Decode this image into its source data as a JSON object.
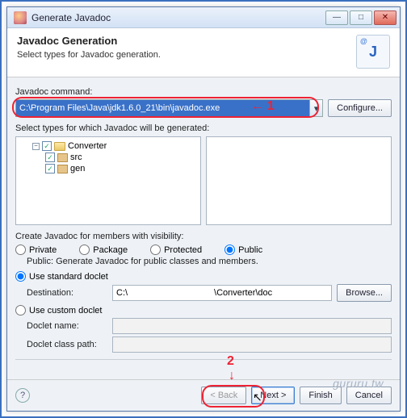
{
  "window": {
    "title": "Generate Javadoc"
  },
  "header": {
    "title": "Javadoc Generation",
    "subtitle": "Select types for Javadoc generation."
  },
  "cmd": {
    "label": "Javadoc command:",
    "value": "C:\\Program Files\\Java\\jdk1.6.0_21\\bin\\javadoc.exe",
    "configure": "Configure..."
  },
  "types": {
    "label": "Select types for which Javadoc will be generated:",
    "tree": {
      "project": "Converter",
      "children": [
        "src",
        "gen"
      ]
    }
  },
  "visibility": {
    "label": "Create Javadoc for members with visibility:",
    "options": [
      "Private",
      "Package",
      "Protected",
      "Public"
    ],
    "selected": "Public",
    "note": "Public: Generate Javadoc for public classes and members."
  },
  "doclet": {
    "standard_label": "Use standard doclet",
    "dest_label": "Destination:",
    "dest_value": "C:\\                                   \\Converter\\doc",
    "browse": "Browse...",
    "custom_label": "Use custom doclet",
    "name_label": "Doclet name:",
    "name_value": "",
    "cp_label": "Doclet class path:",
    "cp_value": ""
  },
  "footer": {
    "back": "< Back",
    "next": "Next >",
    "finish": "Finish",
    "cancel": "Cancel"
  },
  "markers": {
    "one": "1",
    "two": "2"
  },
  "watermark": "gururu.tw"
}
